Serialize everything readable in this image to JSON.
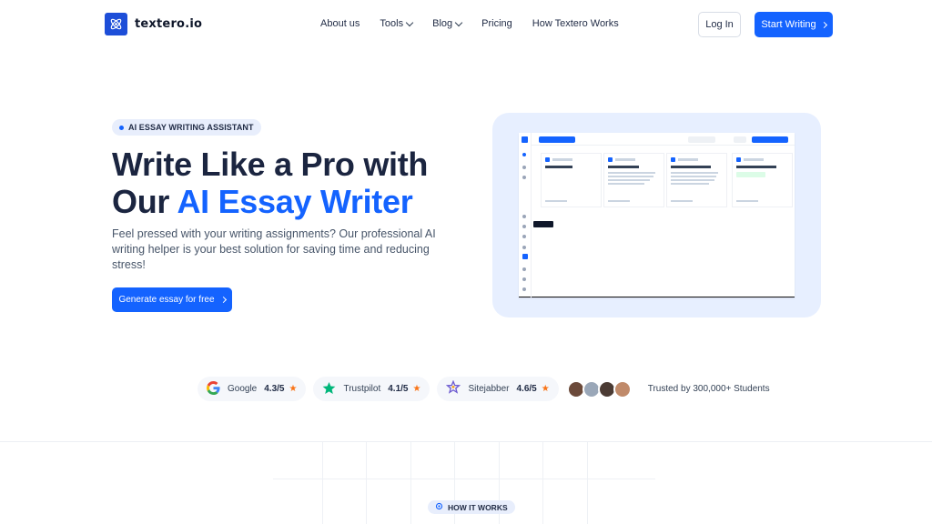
{
  "nav": {
    "brand": "textero.io",
    "links": [
      {
        "label": "About us",
        "has_dropdown": false
      },
      {
        "label": "Tools",
        "has_dropdown": true
      },
      {
        "label": "Blog",
        "has_dropdown": true
      },
      {
        "label": "Pricing",
        "has_dropdown": false
      },
      {
        "label": "How Textero Works",
        "has_dropdown": false
      }
    ],
    "login_label": "Log In",
    "start_label": "Start Writing"
  },
  "hero": {
    "badge": "AI ESSAY WRITING ASSISTANT",
    "title_line1": "Write Like a Pro with",
    "title_line2_plain": "Our ",
    "title_line2_accent": "AI Essay Writer",
    "subtitle": "Feel pressed with your writing assignments? Our professional AI writing helper is your best solution for saving time and reducing stress!",
    "cta_label": "Generate essay for free"
  },
  "ratings": [
    {
      "platform": "Google",
      "score": "4.3/5",
      "icon": "google-icon"
    },
    {
      "platform": "Trustpilot",
      "score": "4.1/5",
      "icon": "trustpilot-star-icon"
    },
    {
      "platform": "Sitejabber",
      "score": "4.6/5",
      "icon": "sitejabber-icon"
    }
  ],
  "trusted_text": "Trusted by 300,000+ Students",
  "how_it_works_badge": "HOW IT WORKS",
  "colors": {
    "accent": "#1463ff",
    "title": "#1b2540",
    "mock_background": "#e7efff",
    "star": "#f97316"
  }
}
